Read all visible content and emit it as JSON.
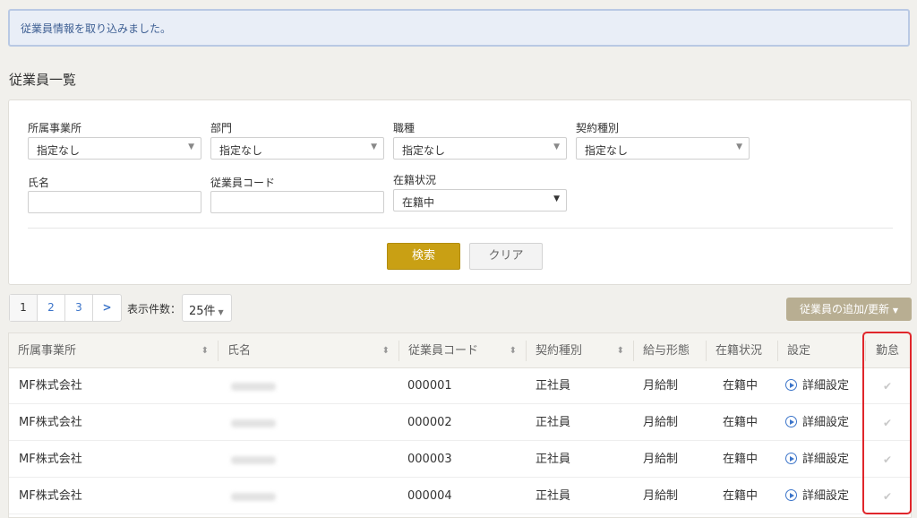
{
  "alert": {
    "message": "従業員情報を取り込みました。"
  },
  "page_title": "従業員一覧",
  "filters": {
    "office": {
      "label": "所属事業所",
      "value": "指定なし"
    },
    "department": {
      "label": "部門",
      "value": "指定なし"
    },
    "job_type": {
      "label": "職種",
      "value": "指定なし"
    },
    "contract_type": {
      "label": "契約種別",
      "value": "指定なし"
    },
    "name": {
      "label": "氏名",
      "value": ""
    },
    "employee_code": {
      "label": "従業員コード",
      "value": ""
    },
    "enrollment": {
      "label": "在籍状況",
      "value": "在籍中"
    },
    "search_label": "検索",
    "clear_label": "クリア"
  },
  "pagination": {
    "pages": [
      "1",
      "2",
      "3"
    ],
    "next_label": ">",
    "per_page_label": "表示件数：",
    "per_page_value": "25件"
  },
  "add_button_label": "従業員の追加/更新",
  "table": {
    "headers": [
      "所属事業所",
      "氏名",
      "従業員コード",
      "契約種別",
      "給与形態",
      "在籍状況",
      "設定",
      "勤怠"
    ],
    "detail_label": "詳細設定",
    "rows": [
      {
        "office": "MF株式会社",
        "code": "000001",
        "contract": "正社員",
        "pay": "月給制",
        "status": "在籍中"
      },
      {
        "office": "MF株式会社",
        "code": "000002",
        "contract": "正社員",
        "pay": "月給制",
        "status": "在籍中"
      },
      {
        "office": "MF株式会社",
        "code": "000003",
        "contract": "正社員",
        "pay": "月給制",
        "status": "在籍中"
      },
      {
        "office": "MF株式会社",
        "code": "000004",
        "contract": "正社員",
        "pay": "月給制",
        "status": "在籍中"
      }
    ]
  },
  "colors": {
    "accent": "#c9a014",
    "link": "#3b74c9",
    "highlight": "#e0262b"
  }
}
